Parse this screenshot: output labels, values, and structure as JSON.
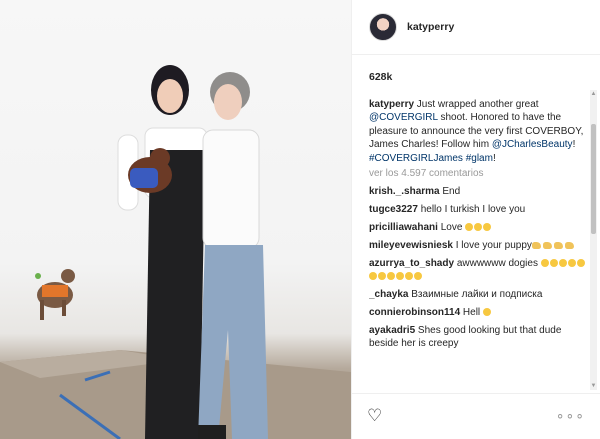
{
  "post": {
    "username": "katyperry",
    "likes": "628k",
    "caption": {
      "username": "katyperry",
      "text_1": " Just wrapped another great ",
      "mention_1": "@COVERGIRL",
      "text_2": " shoot. Honored to have the pleasure to announce the very first COVERBOY, James Charles! Follow him ",
      "mention_2": "@JCharlesBeauty",
      "text_3": "! ",
      "hashtag_1": "#COVERGIRLJames",
      "text_4": " ",
      "hashtag_2": "#glam",
      "text_5": "!"
    },
    "view_all": "ver los 4.597 comentarios"
  },
  "comments": [
    {
      "user": "krish._.sharma",
      "text": " End"
    },
    {
      "user": "tugce3227",
      "text": " hello I turkish I love you"
    },
    {
      "user": "pricilliawahani",
      "text": " Love "
    },
    {
      "user": "mileyevewisniesk",
      "text": " I love your puppy"
    },
    {
      "user": "azurrya_to_shady",
      "text": " awwwwww dogies "
    },
    {
      "user": "_chayka",
      "text": " Взаимные лайки и подписка"
    },
    {
      "user": "connierobinson114",
      "text": " Hell "
    },
    {
      "user": "ayakadri5",
      "text": " Shes good looking but that dude beside her is creepy"
    }
  ],
  "icons": {
    "heart": "♡",
    "more": "∘∘∘",
    "scroll_up": "▲",
    "scroll_down": "▼"
  }
}
